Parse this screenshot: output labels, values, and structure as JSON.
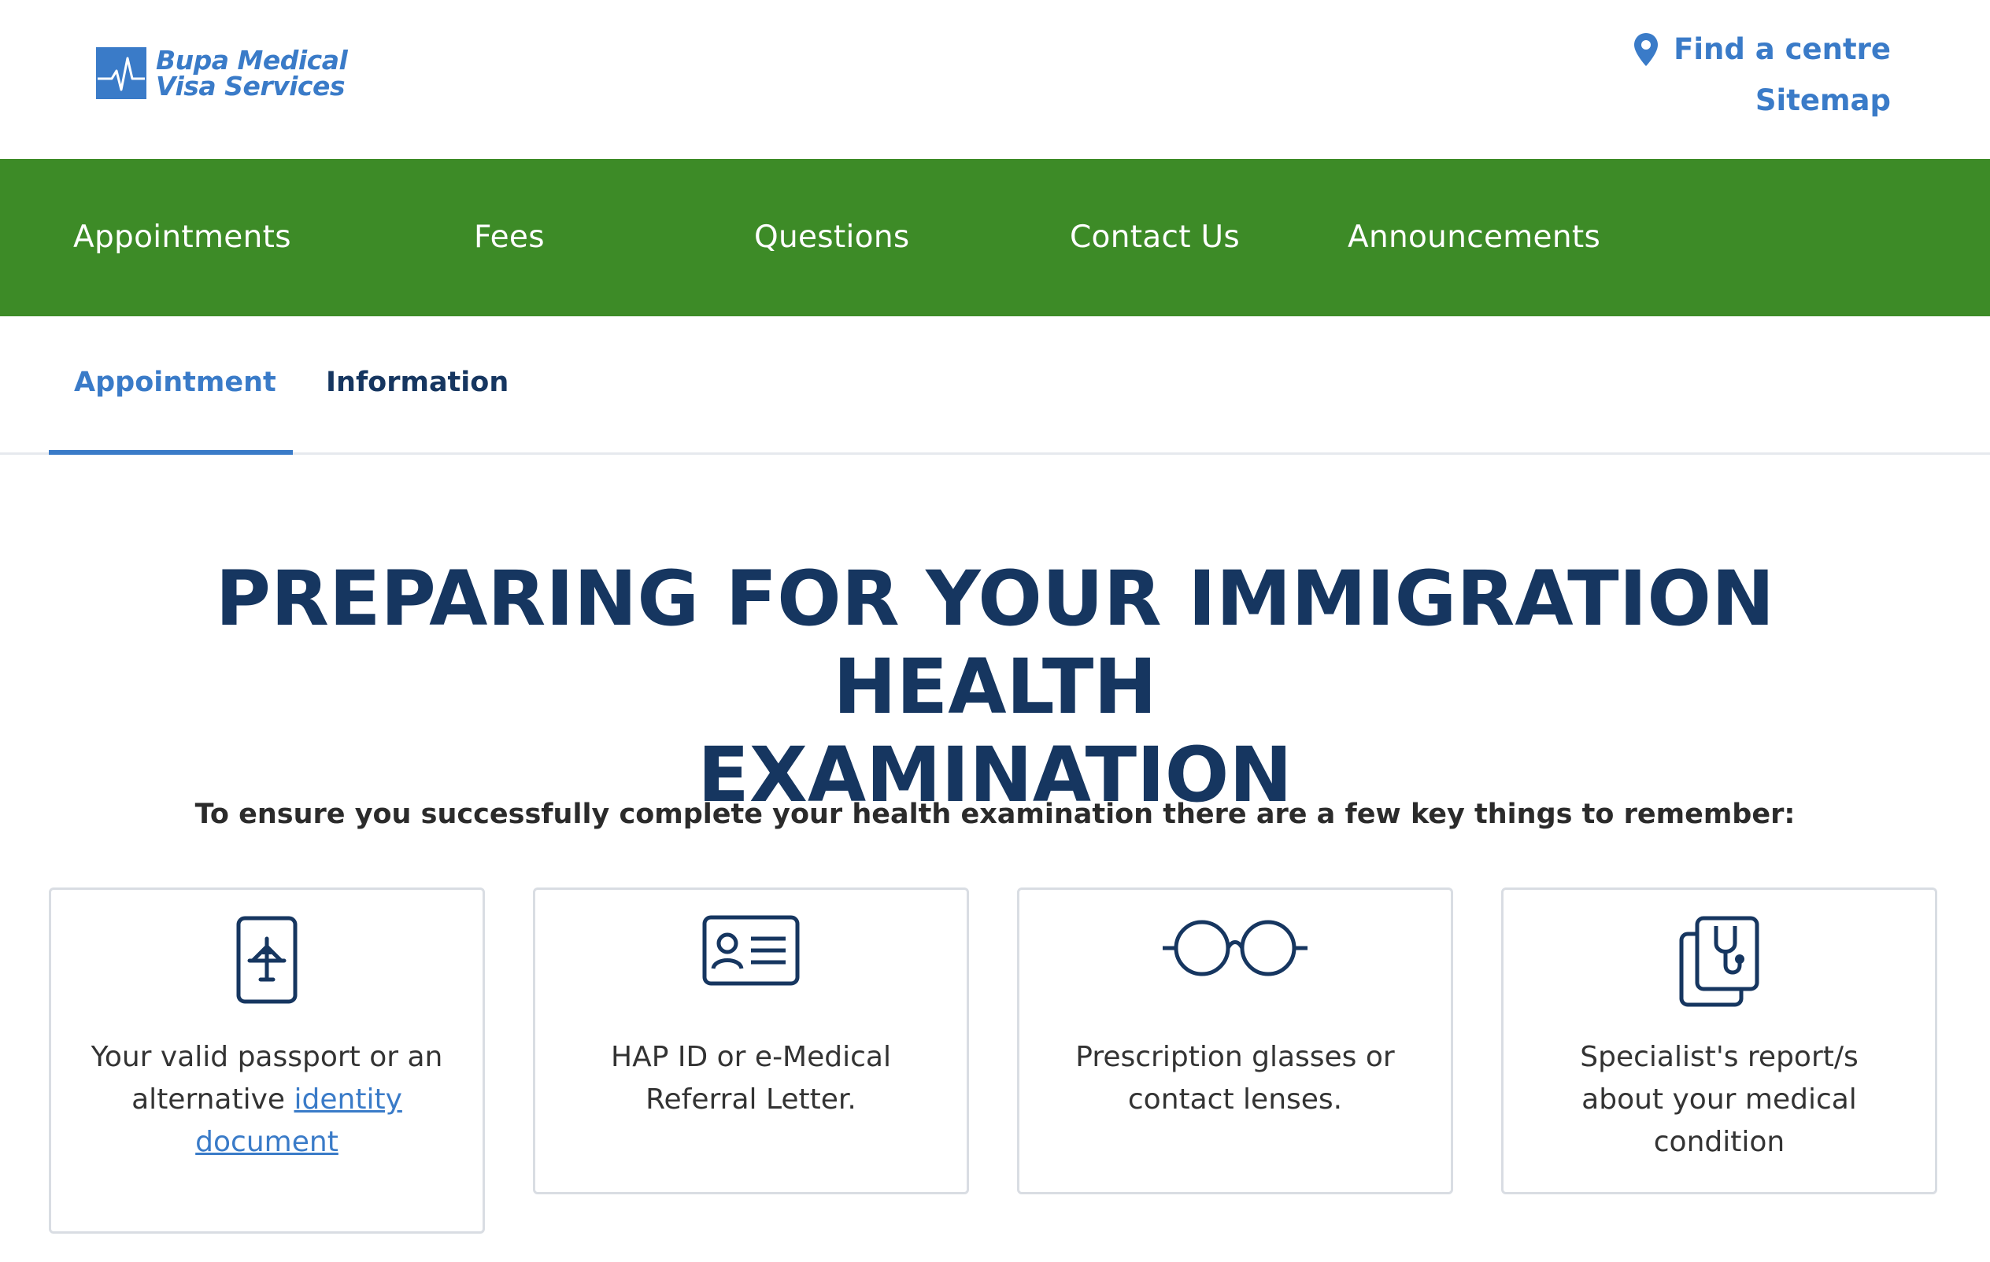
{
  "brand": {
    "logo_line1": "Bupa Medical",
    "logo_line2": "Visa Services",
    "color": "#3a7bc8",
    "logo_icon": "heartbeat-logo-icon"
  },
  "top_links": {
    "find_centre": "Find a centre",
    "find_centre_icon": "map-pin-icon",
    "sitemap": "Sitemap"
  },
  "nav": {
    "background": "#3d8b27",
    "items": [
      {
        "label": "Appointments"
      },
      {
        "label": "Fees"
      },
      {
        "label": "Questions"
      },
      {
        "label": "Contact Us"
      },
      {
        "label": "Announcements"
      }
    ]
  },
  "tabs": [
    {
      "label": "Appointment",
      "active": true
    },
    {
      "label": "Information",
      "active": false
    }
  ],
  "main": {
    "heading_line1": "PREPARING FOR YOUR IMMIGRATION HEALTH",
    "heading_line2": "EXAMINATION",
    "subheading": "To ensure you successfully complete your health examination there are a few key things to remember:"
  },
  "cards": [
    {
      "icon": "passport-icon",
      "text_before": "Your valid passport or an alternative ",
      "link_text": "identity document"
    },
    {
      "icon": "id-card-icon",
      "text": "HAP ID or e-Medical Referral Letter."
    },
    {
      "icon": "glasses-icon",
      "text": "Prescription glasses or contact lenses."
    },
    {
      "icon": "medical-report-icon",
      "text": "Specialist's report/s about your medical condition"
    }
  ]
}
